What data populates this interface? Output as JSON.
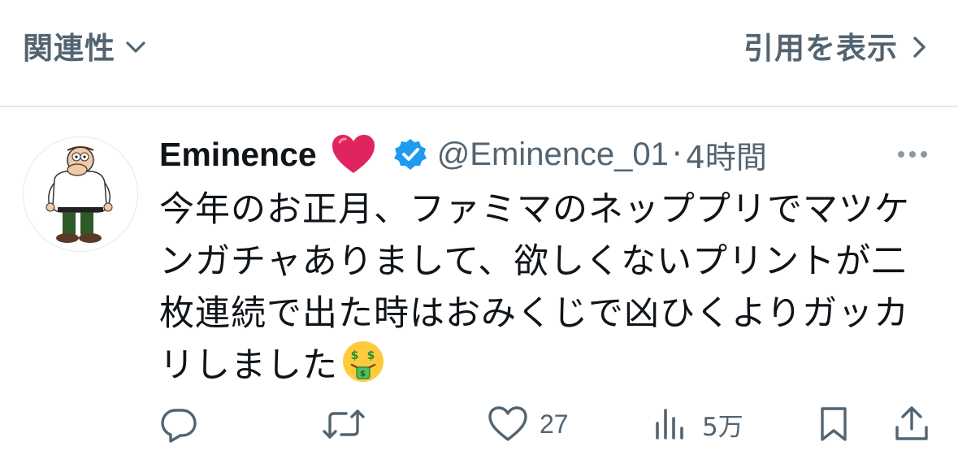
{
  "header": {
    "sort_label": "関連性",
    "quotes_label": "引用を表示"
  },
  "tweet": {
    "display_name": "Eminence",
    "handle": "@Eminence_01",
    "separator": "·",
    "time": "4時間",
    "text": "今年のお正月、ファミマのネッププリでマツケンガチャありまして、欲しくないプリントが二枚連続で出た時はおみくじで凶ひくよりガッカリしました",
    "emoji": "🤑",
    "accent_color": "#1d9bf0",
    "heart_color": "#e0245e"
  },
  "actions": {
    "reply_count": "",
    "retweet_count": "",
    "like_count": "27",
    "views_count": "5万"
  }
}
